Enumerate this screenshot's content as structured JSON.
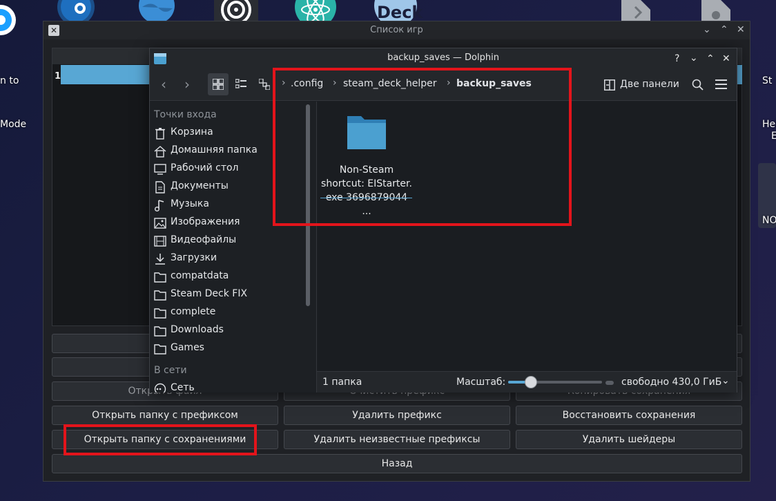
{
  "desktop": {
    "left_label_line1": "n to",
    "left_label_line2": "Mode",
    "right_label_line1": "St",
    "right_label_line2": "Hel",
    "right_label_mid": "E",
    "right_label_bottom": "NO",
    "deck_icon_text": "Deck"
  },
  "games_window": {
    "title": "Список игр",
    "row_number": "1",
    "buttons": {
      "open_file": "Открыть файл",
      "clear_prefix": "Очистить префикс",
      "copy_saves": "Копировать сохранения",
      "open_prefix_folder": "Открыть папку с префиксом",
      "delete_prefix": "Удалить префикс",
      "restore_saves": "Восстановить сохранения",
      "open_saves_folder": "Открыть папку с сохранениями",
      "delete_unknown_prefixes": "Удалить неизвестные префиксы",
      "delete_shaders": "Удалить шейдеры",
      "back": "Назад"
    }
  },
  "dolphin": {
    "title": "backup_saves — Dolphin",
    "help": "?",
    "breadcrumbs": [
      ".config",
      "steam_deck_helper",
      "backup_saves"
    ],
    "split_label": "Две панели",
    "sidebar": {
      "places_header": "Точки входа",
      "network_header": "В сети",
      "items": [
        {
          "label": "Корзина",
          "icon": "trash-icon"
        },
        {
          "label": "Домашняя папка",
          "icon": "home-icon"
        },
        {
          "label": "Рабочий стол",
          "icon": "desktop-icon"
        },
        {
          "label": "Документы",
          "icon": "document-icon"
        },
        {
          "label": "Музыка",
          "icon": "music-icon"
        },
        {
          "label": "Изображения",
          "icon": "image-icon"
        },
        {
          "label": "Видеофайлы",
          "icon": "video-icon"
        },
        {
          "label": "Загрузки",
          "icon": "download-icon"
        },
        {
          "label": "compatdata",
          "icon": "folder-icon"
        },
        {
          "label": "Steam Deck FIX",
          "icon": "folder-icon"
        },
        {
          "label": "complete",
          "icon": "folder-icon"
        },
        {
          "label": "Downloads",
          "icon": "folder-icon"
        },
        {
          "label": "Games",
          "icon": "folder-icon"
        }
      ],
      "network_item": "Сеть"
    },
    "content": {
      "folder_line1": "Non-Steam",
      "folder_line2": "shortcut: EIStarter.",
      "folder_line3": "exe 3696879044 ..."
    },
    "status": {
      "count": "1 папка",
      "zoom_label": "Масштаб:",
      "zoom_fraction": 0.2,
      "free_space": "свободно 430,0 ГиБ"
    }
  },
  "colors": {
    "accent": "#58a7d4",
    "annotation": "#e3141b",
    "folder": "#4ba0d0"
  }
}
